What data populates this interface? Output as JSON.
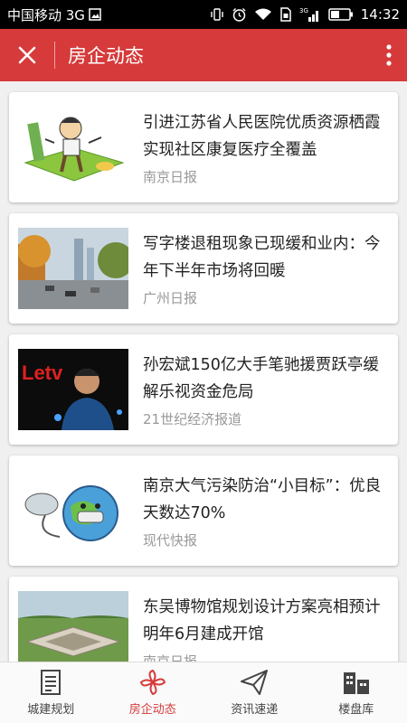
{
  "status_bar": {
    "carrier": "中国移动 3G",
    "time": "14:32",
    "network_label": "3G"
  },
  "app_bar": {
    "title": "房企动态"
  },
  "articles": [
    {
      "headline": "引进江苏省人民医院优质资源栖霞实现社区康复医疗全覆盖",
      "source": "南京日报"
    },
    {
      "headline": "写字楼退租现象已现缓和业内：今年下半年市场将回暖",
      "source": "广州日报"
    },
    {
      "headline": "孙宏斌150亿大手笔驰援贾跃亭缓解乐视资金危局",
      "source": "21世纪经济报道",
      "thumb_text": "Letv"
    },
    {
      "headline": "南京大气污染防治“小目标”：优良天数达70%",
      "source": "现代快报"
    },
    {
      "headline": "东吴博物馆规划设计方案亮相预计明年6月建成开馆",
      "source": "南京日报"
    }
  ],
  "tabs": [
    {
      "label": "城建规划",
      "icon": "document-icon"
    },
    {
      "label": "房企动态",
      "icon": "pinwheel-icon"
    },
    {
      "label": "资讯速递",
      "icon": "paper-plane-icon"
    },
    {
      "label": "楼盘库",
      "icon": "buildings-icon"
    }
  ],
  "active_tab": "房企动态",
  "colors": {
    "accent": "#d63a3a",
    "status_bar": "#000000",
    "background": "#f0f0f0"
  }
}
